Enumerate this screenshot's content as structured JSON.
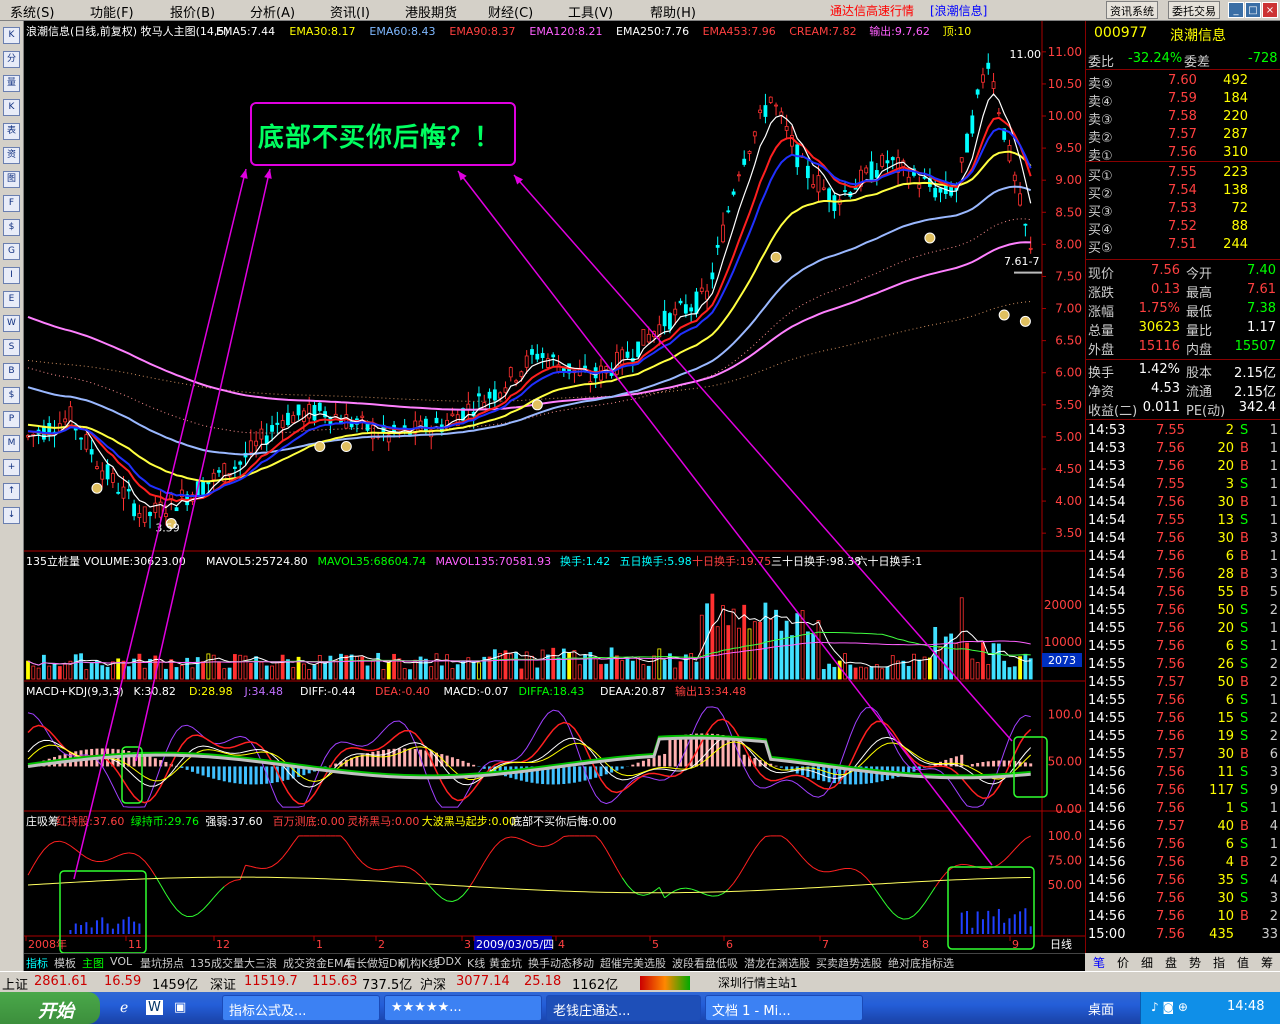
{
  "menu": {
    "items": [
      "系统(S)",
      "功能(F)",
      "报价(B)",
      "分析(A)",
      "资讯(I)",
      "港股期货",
      "财经(C)",
      "工具(V)",
      "帮助(H)"
    ],
    "right_title": "通达信高速行情",
    "right_stock": "[浪潮信息]",
    "btn_news": "资讯系统",
    "btn_trade": "委托交易"
  },
  "chart": {
    "title": "浪潮信息(日线,前复权) 牧马人主图(14,5)",
    "ema_labels": [
      {
        "t": "EMA5:7.44",
        "c": "#ffffff"
      },
      {
        "t": "EMA30:8.17",
        "c": "#ffff00"
      },
      {
        "t": "EMA60:8.43",
        "c": "#7fb8ff"
      },
      {
        "t": "EMA90:8.37",
        "c": "#ff4040"
      },
      {
        "t": "EMA120:8.21",
        "c": "#ff60ff"
      },
      {
        "t": "EMA250:7.76",
        "c": "#ffffff"
      },
      {
        "t": "EMA453:7.96",
        "c": "#ff4040"
      },
      {
        "t": "CREAM:7.82",
        "c": "#ff4040"
      },
      {
        "t": "输出:9.7,62",
        "c": "#ff60ff"
      },
      {
        "t": "顶:10",
        "c": "#ffff00"
      }
    ],
    "price_axis": [
      "11.00",
      "10.50",
      "10.00",
      "9.50",
      "9.00",
      "8.50",
      "8.00",
      "7.50",
      "7.00",
      "6.50",
      "6.00",
      "5.50",
      "5.00",
      "4.50",
      "4.00",
      "3.50"
    ],
    "high_label": "11.00",
    "low_label": "3.59",
    "last_label": "7.61-7",
    "callout": "底部不买你后悔？！",
    "volume": {
      "title": "135立桩量 VOLUME:30623.00",
      "labels": [
        {
          "t": "MAVOL5:25724.80",
          "c": "#ffffff"
        },
        {
          "t": "MAVOL35:68604.74",
          "c": "#00ff00"
        },
        {
          "t": "MAVOL135:70581.93",
          "c": "#ff60ff"
        },
        {
          "t": "换手:1.42",
          "c": "#00ffff"
        },
        {
          "t": "五日换手:5.98",
          "c": "#00ffff"
        },
        {
          "t": "十日换手:19.75",
          "c": "#ff4040"
        },
        {
          "t": "三十日换手:98.38",
          "c": "#ffffff"
        },
        {
          "t": "六十日换手:1",
          "c": "#ffffff"
        }
      ],
      "axis": [
        "20000",
        "10000"
      ],
      "tag": "2073"
    },
    "macd": {
      "labels": [
        {
          "t": "MACD+KDJ(9,3,3)",
          "c": "#ffffff"
        },
        {
          "t": "K:30.82",
          "c": "#ffffff"
        },
        {
          "t": "D:28.98",
          "c": "#ffff00"
        },
        {
          "t": "J:34.48",
          "c": "#c070ff"
        },
        {
          "t": "DIFF:-0.44",
          "c": "#ffffff"
        },
        {
          "t": "DEA:-0.40",
          "c": "#ff4040"
        },
        {
          "t": "MACD:-0.07",
          "c": "#ffffff"
        },
        {
          "t": "DIFFA:18.43",
          "c": "#00ff00"
        },
        {
          "t": "DEAA:20.87",
          "c": "#ffffff"
        },
        {
          "t": "输出13:34.48",
          "c": "#ff4040"
        }
      ],
      "axis": [
        "100.0",
        "50.00",
        "0.00"
      ]
    },
    "zxc": {
      "labels": [
        {
          "t": "庄吸筹",
          "c": "#ffffff"
        },
        {
          "t": "红持股:37.60",
          "c": "#ff4040"
        },
        {
          "t": "绿持币:29.76",
          "c": "#00ff00"
        },
        {
          "t": "强弱:37.60",
          "c": "#ffffff"
        },
        {
          "t": "百万测底:0.00",
          "c": "#ff4040"
        },
        {
          "t": "灵桥黑马:0.00",
          "c": "#ff4040"
        },
        {
          "t": "大波黑马起步:0.00",
          "c": "#ffff00"
        },
        {
          "t": "底部不买你后悔:0.00",
          "c": "#ffffff"
        }
      ],
      "axis": [
        "100.0",
        "75.00",
        "50.00"
      ]
    },
    "dates": [
      "2008年",
      "11",
      "12",
      "1",
      "2",
      "3",
      "2009/03/05/四",
      "4",
      "5",
      "6",
      "7",
      "8",
      "9"
    ],
    "period": "日线"
  },
  "quote": {
    "code": "000977",
    "name": "浪潮信息",
    "weibi_label": "委比",
    "weibi": "-32.24%",
    "weicha_label": "委差",
    "weicha": "-728",
    "sells": [
      {
        "l": "卖⑤",
        "p": "7.60",
        "v": "492"
      },
      {
        "l": "卖④",
        "p": "7.59",
        "v": "184"
      },
      {
        "l": "卖③",
        "p": "7.58",
        "v": "220"
      },
      {
        "l": "卖②",
        "p": "7.57",
        "v": "287"
      },
      {
        "l": "卖①",
        "p": "7.56",
        "v": "310"
      }
    ],
    "buys": [
      {
        "l": "买①",
        "p": "7.55",
        "v": "223"
      },
      {
        "l": "买②",
        "p": "7.54",
        "v": "138"
      },
      {
        "l": "买③",
        "p": "7.53",
        "v": "72"
      },
      {
        "l": "买④",
        "p": "7.52",
        "v": "88"
      },
      {
        "l": "买⑤",
        "p": "7.51",
        "v": "244"
      }
    ],
    "stats": [
      {
        "a": "现价",
        "av": "7.56",
        "b": "今开",
        "bv": "7.40",
        "ac": "#ff4040",
        "bc": "#00ff00"
      },
      {
        "a": "涨跌",
        "av": "0.13",
        "b": "最高",
        "bv": "7.61",
        "ac": "#ff4040",
        "bc": "#ff4040"
      },
      {
        "a": "涨幅",
        "av": "1.75%",
        "b": "最低",
        "bv": "7.38",
        "ac": "#ff4040",
        "bc": "#00ff00"
      },
      {
        "a": "总量",
        "av": "30623",
        "b": "量比",
        "bv": "1.17",
        "ac": "#ffff00",
        "bc": "#ffffff"
      },
      {
        "a": "外盘",
        "av": "15116",
        "b": "内盘",
        "bv": "15507",
        "ac": "#ff4040",
        "bc": "#00ff00"
      },
      {
        "a": "换手",
        "av": "1.42%",
        "b": "股本",
        "bv": "2.15亿",
        "ac": "#ffffff",
        "bc": "#ffffff"
      },
      {
        "a": "净资",
        "av": "4.53",
        "b": "流通",
        "bv": "2.15亿",
        "ac": "#ffffff",
        "bc": "#ffffff"
      },
      {
        "a": "收益(二)",
        "av": "0.011",
        "b": "PE(动)",
        "bv": "342.4",
        "ac": "#ffffff",
        "bc": "#ffffff"
      }
    ],
    "ticks": [
      [
        "14:53",
        "7.55",
        "2",
        "S",
        "1"
      ],
      [
        "14:53",
        "7.56",
        "20",
        "B",
        "1"
      ],
      [
        "14:53",
        "7.56",
        "20",
        "B",
        "1"
      ],
      [
        "14:54",
        "7.55",
        "3",
        "S",
        "1"
      ],
      [
        "14:54",
        "7.56",
        "30",
        "B",
        "1"
      ],
      [
        "14:54",
        "7.55",
        "13",
        "S",
        "1"
      ],
      [
        "14:54",
        "7.56",
        "30",
        "B",
        "3"
      ],
      [
        "14:54",
        "7.56",
        "6",
        "B",
        "1"
      ],
      [
        "14:54",
        "7.56",
        "28",
        "B",
        "3"
      ],
      [
        "14:54",
        "7.56",
        "55",
        "B",
        "5"
      ],
      [
        "14:55",
        "7.56",
        "50",
        "S",
        "2"
      ],
      [
        "14:55",
        "7.56",
        "20",
        "S",
        "1"
      ],
      [
        "14:55",
        "7.56",
        "6",
        "S",
        "1"
      ],
      [
        "14:55",
        "7.56",
        "26",
        "S",
        "2"
      ],
      [
        "14:55",
        "7.57",
        "50",
        "B",
        "2"
      ],
      [
        "14:55",
        "7.56",
        "6",
        "S",
        "1"
      ],
      [
        "14:55",
        "7.56",
        "15",
        "S",
        "2"
      ],
      [
        "14:55",
        "7.56",
        "19",
        "S",
        "2"
      ],
      [
        "14:55",
        "7.57",
        "30",
        "B",
        "6"
      ],
      [
        "14:56",
        "7.56",
        "11",
        "S",
        "3"
      ],
      [
        "14:56",
        "7.56",
        "117",
        "S",
        "9"
      ],
      [
        "14:56",
        "7.56",
        "1",
        "S",
        "1"
      ],
      [
        "14:56",
        "7.57",
        "40",
        "B",
        "4"
      ],
      [
        "14:56",
        "7.56",
        "6",
        "S",
        "1"
      ],
      [
        "14:56",
        "7.56",
        "4",
        "B",
        "2"
      ],
      [
        "14:56",
        "7.56",
        "35",
        "S",
        "4"
      ],
      [
        "14:56",
        "7.56",
        "30",
        "S",
        "3"
      ],
      [
        "14:56",
        "7.56",
        "10",
        "B",
        "2"
      ],
      [
        "15:00",
        "7.56",
        "435",
        "",
        "33"
      ]
    ]
  },
  "bottom_tabs": [
    "指标",
    "模板",
    "主图",
    "VOL",
    "量坑拐点",
    "135成交量",
    "大三浪",
    "成交资金EMA",
    "看长做短DK",
    "机构K线",
    "DDX",
    "K线",
    "黄金坑",
    "换手动态移动",
    "超催完美选股",
    "波段看盘低吸",
    "潜龙在渊选股",
    "买卖趋势选股",
    "绝对底指标选"
  ],
  "right_tabs": [
    "笔",
    "价",
    "细",
    "盘",
    "势",
    "指",
    "值",
    "筹"
  ],
  "status": {
    "sh_label": "上证",
    "sh_val": "2861.61",
    "sh_chg": "16.59",
    "sh_amt": "1459亿",
    "sz_label": "深证",
    "sz_val": "11519.7",
    "sz_chg": "115.63",
    "sz_amt": "737.5亿",
    "hs_label": "沪深",
    "hs_val": "3077.14",
    "hs_chg": "25.18",
    "hs_amt": "1162亿",
    "server": "深圳行情主站1"
  },
  "taskbar": {
    "start": "开始",
    "items": [
      "指标公式及...",
      "★★★★★...",
      "老钱庄通达...",
      "文档 1 - Mi..."
    ],
    "desktop": "桌面",
    "clock": "14:48"
  },
  "left_toolbar": [
    "K",
    "分",
    "量",
    "K",
    "表",
    "资",
    "图",
    "F",
    "$",
    "G",
    "I",
    "E",
    "W",
    "S",
    "B",
    "$",
    "P",
    "M",
    "+",
    "↑",
    "↓"
  ]
}
